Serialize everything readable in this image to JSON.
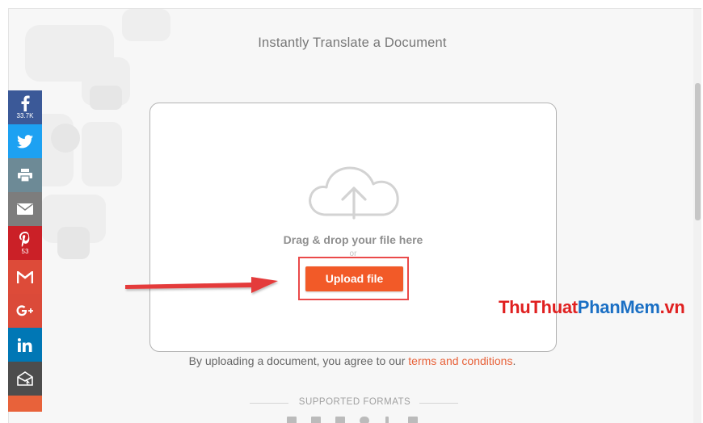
{
  "page": {
    "title": "Instantly Translate a Document"
  },
  "upload": {
    "drag_text": "Drag & drop your file here",
    "or_text": "or",
    "button_label": "Upload file"
  },
  "agreement": {
    "prefix": "By uploading a document, you agree to our ",
    "link_text": "terms and conditions",
    "suffix": "."
  },
  "formats": {
    "heading": "SUPPORTED FORMATS"
  },
  "social": {
    "facebook_count": "33.7K",
    "pinterest_count": "53",
    "icons": [
      "facebook-icon",
      "twitter-icon",
      "print-icon",
      "email-icon",
      "pinterest-icon",
      "gmail-icon",
      "google-plus-icon",
      "linkedin-icon",
      "share-mail-icon"
    ],
    "colors": {
      "facebook": "#3b5998",
      "twitter": "#1da1f2",
      "print": "#6d8a96",
      "email": "#7d7d7d",
      "pinterest": "#cb2027",
      "gmail": "#dd4b39",
      "google_plus": "#db4a39",
      "linkedin": "#0077b5",
      "share": "#4d4d4d"
    }
  },
  "watermark": {
    "part1": "ThuThuat",
    "part2": "PhanMem",
    "part3": ".vn"
  },
  "colors": {
    "accent": "#f25a28",
    "link": "#e8623a",
    "highlight": "#ea4a4a"
  }
}
